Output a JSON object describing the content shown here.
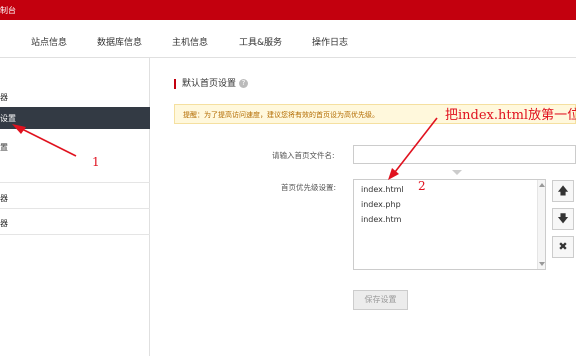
{
  "header": {
    "title": "制台"
  },
  "nav": {
    "items": [
      "站点信息",
      "数据库信息",
      "主机信息",
      "工具&服务",
      "操作日志"
    ]
  },
  "sidebar": {
    "items": [
      "器",
      "设置",
      "置",
      "器",
      "器"
    ]
  },
  "main": {
    "section_title": "默认首页设置",
    "help_icon": "?",
    "notice": "提醒：为了提高访问速度，建议您将有效的首页设为高优先级。",
    "input_label": "请输入首页文件名:",
    "input_value": "",
    "priority_label": "首页优先级设置:",
    "files": [
      "index.html",
      "index.php",
      "index.htm"
    ],
    "buttons": {
      "up": "🡅",
      "down": "🡇",
      "delete": "✖"
    },
    "save_label": "保存设置"
  },
  "annotations": {
    "note": "把index.html放第一位",
    "num1": "1",
    "num2": "2",
    "color": "#e0121f"
  }
}
